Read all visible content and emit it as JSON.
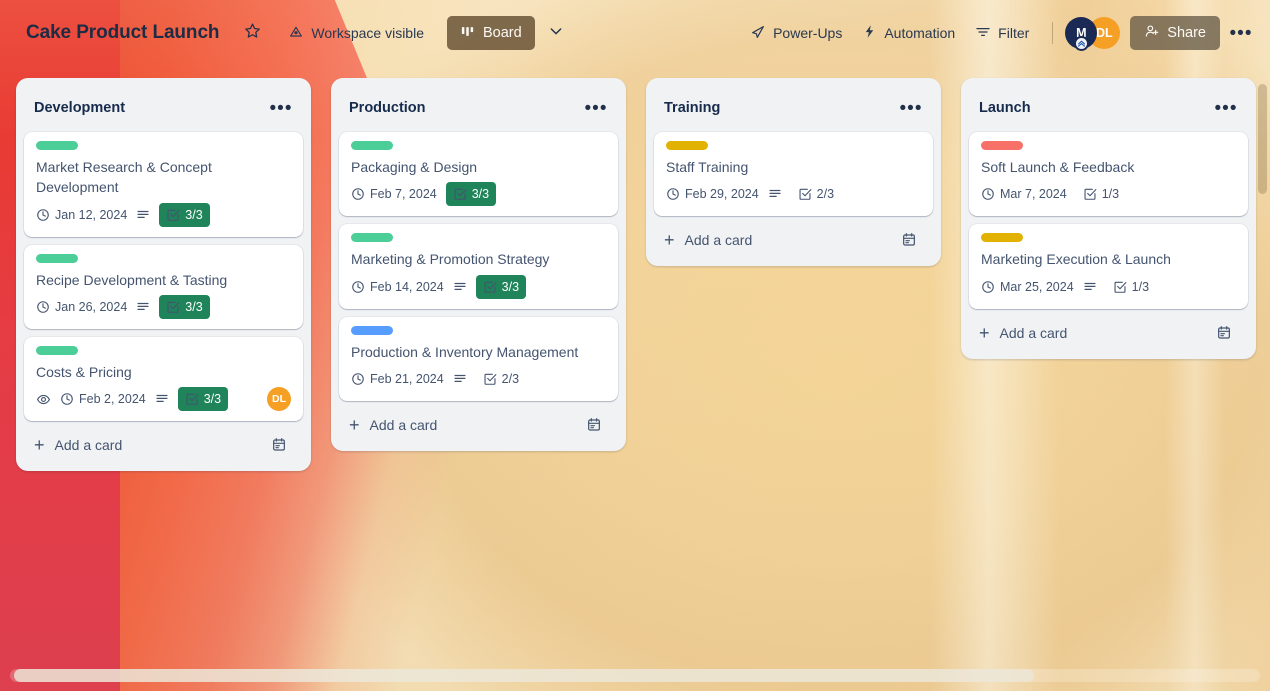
{
  "header": {
    "board_title": "Cake Product Launch",
    "star_icon": "star-icon",
    "workspace_visibility": "Workspace visible",
    "workspace_icon": "workspace-visible-icon",
    "view_button": "Board",
    "view_icon": "board-view-icon",
    "view_chevron_icon": "chevron-down-icon",
    "power_ups": "Power-Ups",
    "power_ups_icon": "power-ups-icon",
    "automation": "Automation",
    "automation_icon": "lightning-bolt-icon",
    "filter": "Filter",
    "filter_icon": "filter-icon",
    "share": "Share",
    "share_icon": "person-add-icon",
    "more_icon": "ellipsis-icon",
    "avatars": [
      {
        "initials": "M",
        "color": "#1b2a55",
        "has_badge": true
      },
      {
        "initials": "DL",
        "color": "#f59f24",
        "has_badge": false
      }
    ]
  },
  "colors": {
    "label_green": "#4bce97",
    "label_yellow": "#e2b203",
    "label_blue": "#579dff",
    "label_red": "#f87168",
    "badge_complete_bg": "#1f845a",
    "list_bg": "#f1f2f4",
    "card_bg": "#ffffff",
    "text": "#44546f",
    "title_text": "#172b4d"
  },
  "add_card": {
    "label": "Add a card",
    "plus_icon": "plus-icon",
    "template_icon": "card-template-icon"
  },
  "list_menu_icon": "ellipsis-icon",
  "icons": {
    "due_date": "clock-icon",
    "description": "description-icon",
    "checklist": "checklist-icon",
    "watch": "eye-watch-icon"
  },
  "lists": [
    {
      "title": "Development",
      "cards": [
        {
          "labels": [
            "#4bce97"
          ],
          "title": "Market Research & Concept Development",
          "due": "Jan 12, 2024",
          "has_description": true,
          "checklist": "3/3",
          "checklist_complete": true,
          "watching": false,
          "member": null
        },
        {
          "labels": [
            "#4bce97"
          ],
          "title": "Recipe Development & Tasting",
          "due": "Jan 26, 2024",
          "has_description": true,
          "checklist": "3/3",
          "checklist_complete": true,
          "watching": false,
          "member": null
        },
        {
          "labels": [
            "#4bce97"
          ],
          "title": "Costs & Pricing",
          "due": "Feb 2, 2024",
          "has_description": true,
          "checklist": "3/3",
          "checklist_complete": true,
          "watching": true,
          "member": "DL"
        }
      ]
    },
    {
      "title": "Production",
      "cards": [
        {
          "labels": [
            "#4bce97"
          ],
          "title": "Packaging & Design",
          "due": "Feb 7, 2024",
          "has_description": false,
          "checklist": "3/3",
          "checklist_complete": true,
          "watching": false,
          "member": null
        },
        {
          "labels": [
            "#4bce97"
          ],
          "title": "Marketing & Promotion Strategy",
          "due": "Feb 14, 2024",
          "has_description": true,
          "checklist": "3/3",
          "checklist_complete": true,
          "watching": false,
          "member": null
        },
        {
          "labels": [
            "#579dff"
          ],
          "title": "Production & Inventory Management",
          "due": "Feb 21, 2024",
          "has_description": true,
          "checklist": "2/3",
          "checklist_complete": false,
          "watching": false,
          "member": null
        }
      ]
    },
    {
      "title": "Training",
      "cards": [
        {
          "labels": [
            "#e2b203"
          ],
          "title": "Staff Training",
          "due": "Feb 29, 2024",
          "has_description": true,
          "checklist": "2/3",
          "checklist_complete": false,
          "watching": false,
          "member": null
        }
      ]
    },
    {
      "title": "Launch",
      "cards": [
        {
          "labels": [
            "#f87168"
          ],
          "title": "Soft Launch & Feedback",
          "due": "Mar 7, 2024",
          "has_description": false,
          "checklist": "1/3",
          "checklist_complete": false,
          "watching": false,
          "member": null
        },
        {
          "labels": [
            "#e2b203"
          ],
          "title": "Marketing Execution & Launch",
          "due": "Mar 25, 2024",
          "has_description": true,
          "checklist": "1/3",
          "checklist_complete": false,
          "watching": false,
          "member": null
        }
      ]
    }
  ]
}
